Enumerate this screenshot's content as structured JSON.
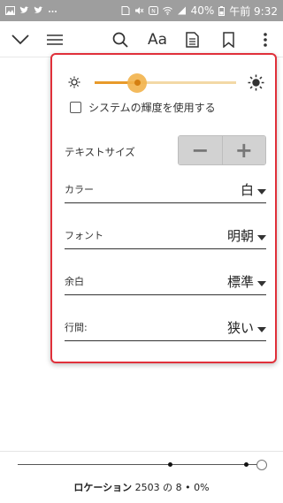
{
  "status_bar": {
    "battery": "40%",
    "time": "午前 9:32",
    "left_icons": [
      "image-icon",
      "twitter-icon",
      "twitter-icon",
      "ellipsis-icon"
    ],
    "right_icons": [
      "sim-icon",
      "mute-icon",
      "nfc-icon",
      "wifi-icon",
      "signal-icon",
      "battery-icon"
    ]
  },
  "toolbar": {
    "font_button_label": "Aa",
    "icons": [
      "chevron-down-icon",
      "menu-icon",
      "search-icon",
      "notes-icon",
      "bookmark-icon",
      "more-vertical-icon"
    ]
  },
  "display_settings": {
    "brightness": {
      "level": 0.3,
      "min_icon": "sun-small-icon",
      "max_icon": "sun-large-icon"
    },
    "system_brightness_label": "システムの輝度を使用する",
    "system_brightness_checked": false,
    "text_size_label": "テキストサイズ",
    "decrease_symbol": "−",
    "increase_symbol": "+",
    "settings": [
      {
        "label": "カラー",
        "value": "白"
      },
      {
        "label": "フォント",
        "value": "明朝"
      },
      {
        "label": "余白",
        "value": "標準"
      },
      {
        "label": "行間:",
        "value": "狭い"
      }
    ]
  },
  "reading_progress": {
    "label": "ロケーション",
    "location_text": "2503 の 8 • 0%",
    "position": 1.0,
    "markers": [
      0.62,
      0.93
    ]
  },
  "colors": {
    "accent": "#e89a2a",
    "highlight_border": "#e0303a",
    "status_bar": "#9e9e9e"
  }
}
